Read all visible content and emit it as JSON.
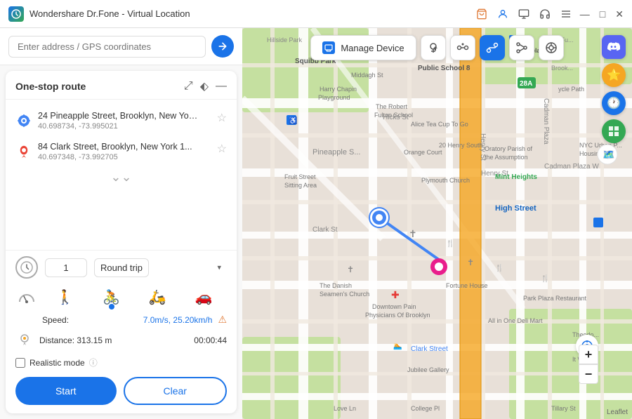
{
  "app": {
    "title": "Wondershare Dr.Fone - Virtual Location"
  },
  "titlebar": {
    "controls": [
      "—",
      "□",
      "✕"
    ]
  },
  "search": {
    "placeholder": "Enter address / GPS coordinates"
  },
  "route_panel": {
    "title": "One-stop route",
    "waypoints": [
      {
        "name": "24 Pineapple Street, Brooklyn, New York ...",
        "coords": "40.698734, -73.995021"
      },
      {
        "name": "84 Clark Street, Brooklyn, New York 1...",
        "coords": "40.697348, -73.992705"
      }
    ]
  },
  "controls": {
    "trip_count": "1",
    "trip_type": "Round trip",
    "speed_label": "Speed:",
    "speed_value": "7.0m/s, 25.20km/h",
    "distance_label": "Distance: 313.15 m",
    "distance_time": "00:00:44",
    "realistic_label": "Realistic mode"
  },
  "buttons": {
    "start": "Start",
    "clear": "Clear",
    "manage_device": "Manage Device"
  },
  "map": {
    "attribution": "Leaflet"
  }
}
